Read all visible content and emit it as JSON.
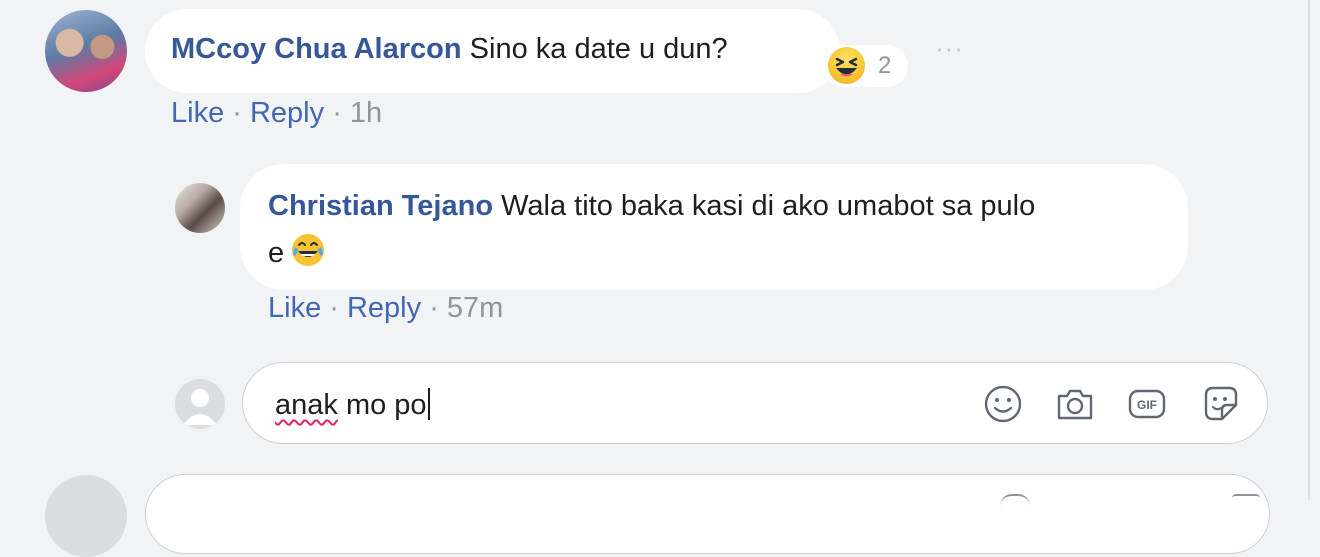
{
  "comment": {
    "author": "MCcoy Chua Alarcon",
    "text": "Sino ka date u dun?",
    "reaction_icon": "laughing-face-icon",
    "reaction_count": "2",
    "more_label": "···",
    "actions": {
      "like": "Like",
      "reply": "Reply",
      "separator": " · ",
      "time": "1h"
    }
  },
  "reply": {
    "author": "Christian Tejano",
    "text_line1": "Wala tito baka kasi di ako umabot sa pulo",
    "text_line2": "e",
    "emoji_icon": "tears-of-joy-icon",
    "actions": {
      "like": "Like",
      "reply": "Reply",
      "separator": " · ",
      "time": "57m"
    }
  },
  "reply_input": {
    "value_word1": "anak",
    "value_rest": " mo po",
    "tools": [
      "emoji-icon",
      "camera-icon",
      "gif-icon",
      "sticker-icon"
    ]
  },
  "colors": {
    "author": "#365899",
    "link": "#4267b2",
    "muted": "#90949c",
    "background": "#f2f3f5"
  }
}
